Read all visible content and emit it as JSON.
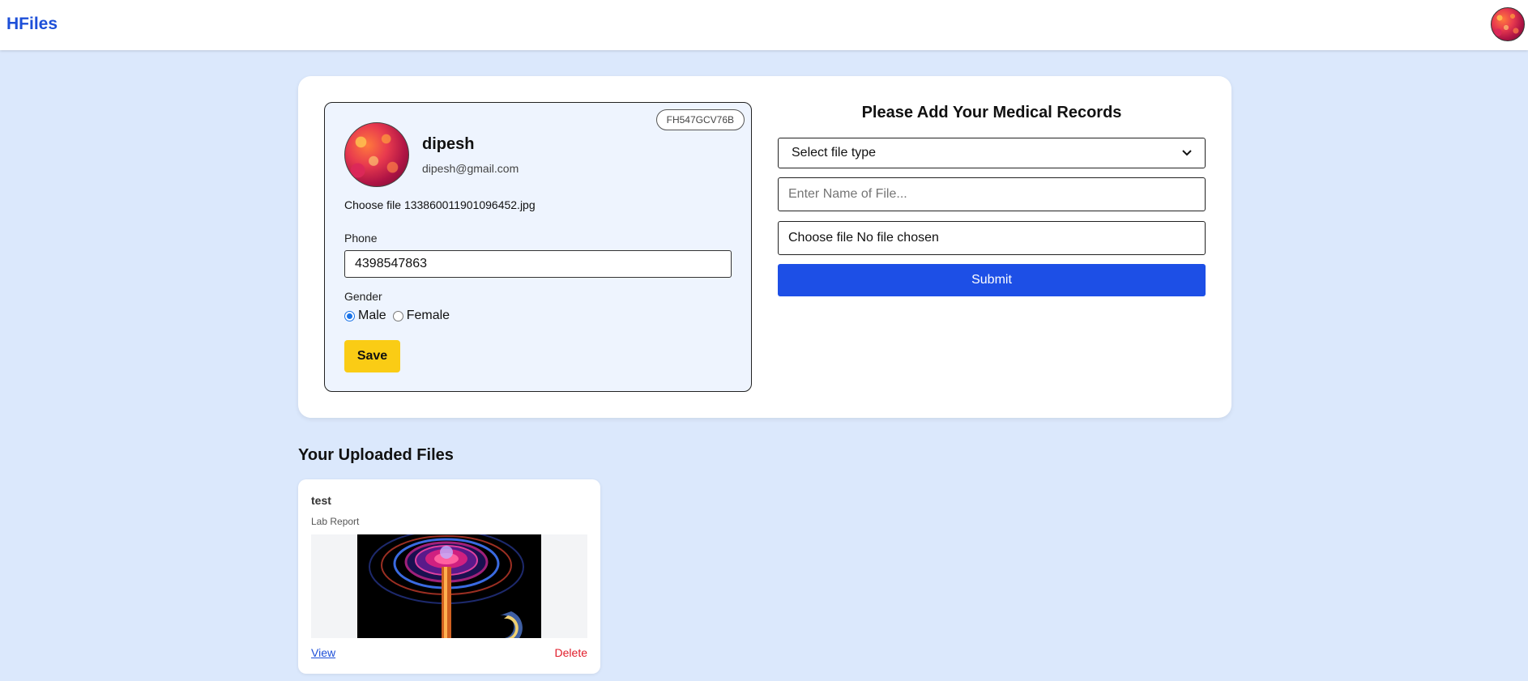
{
  "header": {
    "brand": "HFiles",
    "avatar_icon": "user-avatar-icon"
  },
  "profile": {
    "id_badge": "FH547GCV76B",
    "name": "dipesh",
    "email": "dipesh@gmail.com",
    "file_picker": {
      "button_label": "Choose file",
      "file_name": "133860011901096452.jpg"
    },
    "phone_label": "Phone",
    "phone_value": "4398547863",
    "gender_label": "Gender",
    "gender_options": [
      "Male",
      "Female"
    ],
    "gender_selected": "Male",
    "save_label": "Save"
  },
  "records_form": {
    "title": "Please Add Your Medical Records",
    "file_type_select": "Select file type",
    "file_name_placeholder": "Enter Name of File...",
    "file_input_label": "Choose file",
    "file_input_status": "No file chosen",
    "submit_label": "Submit"
  },
  "uploaded": {
    "title": "Your Uploaded Files",
    "files": [
      {
        "name": "test",
        "type": "Lab Report",
        "view_label": "View",
        "delete_label": "Delete"
      }
    ]
  },
  "colors": {
    "page_bg": "#dbe8fc",
    "brand": "#1d4fd8",
    "save_button": "#facc15",
    "submit_button": "#1d4fe6",
    "delete": "#e11d2a"
  }
}
